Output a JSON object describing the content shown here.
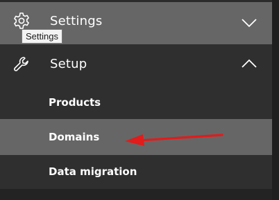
{
  "nav": {
    "settings": {
      "label": "Settings",
      "icon": "gear-icon",
      "expanded": false,
      "tooltip": "Settings"
    },
    "setup": {
      "label": "Setup",
      "icon": "wrench-icon",
      "expanded": true,
      "items": [
        {
          "label": "Products",
          "selected": false
        },
        {
          "label": "Domains",
          "selected": true
        },
        {
          "label": "Data migration",
          "selected": false
        }
      ]
    }
  },
  "colors": {
    "background": "#2b2b2b",
    "highlight": "#666666",
    "text": "#ffffff",
    "annotation": "#e21b1b"
  }
}
